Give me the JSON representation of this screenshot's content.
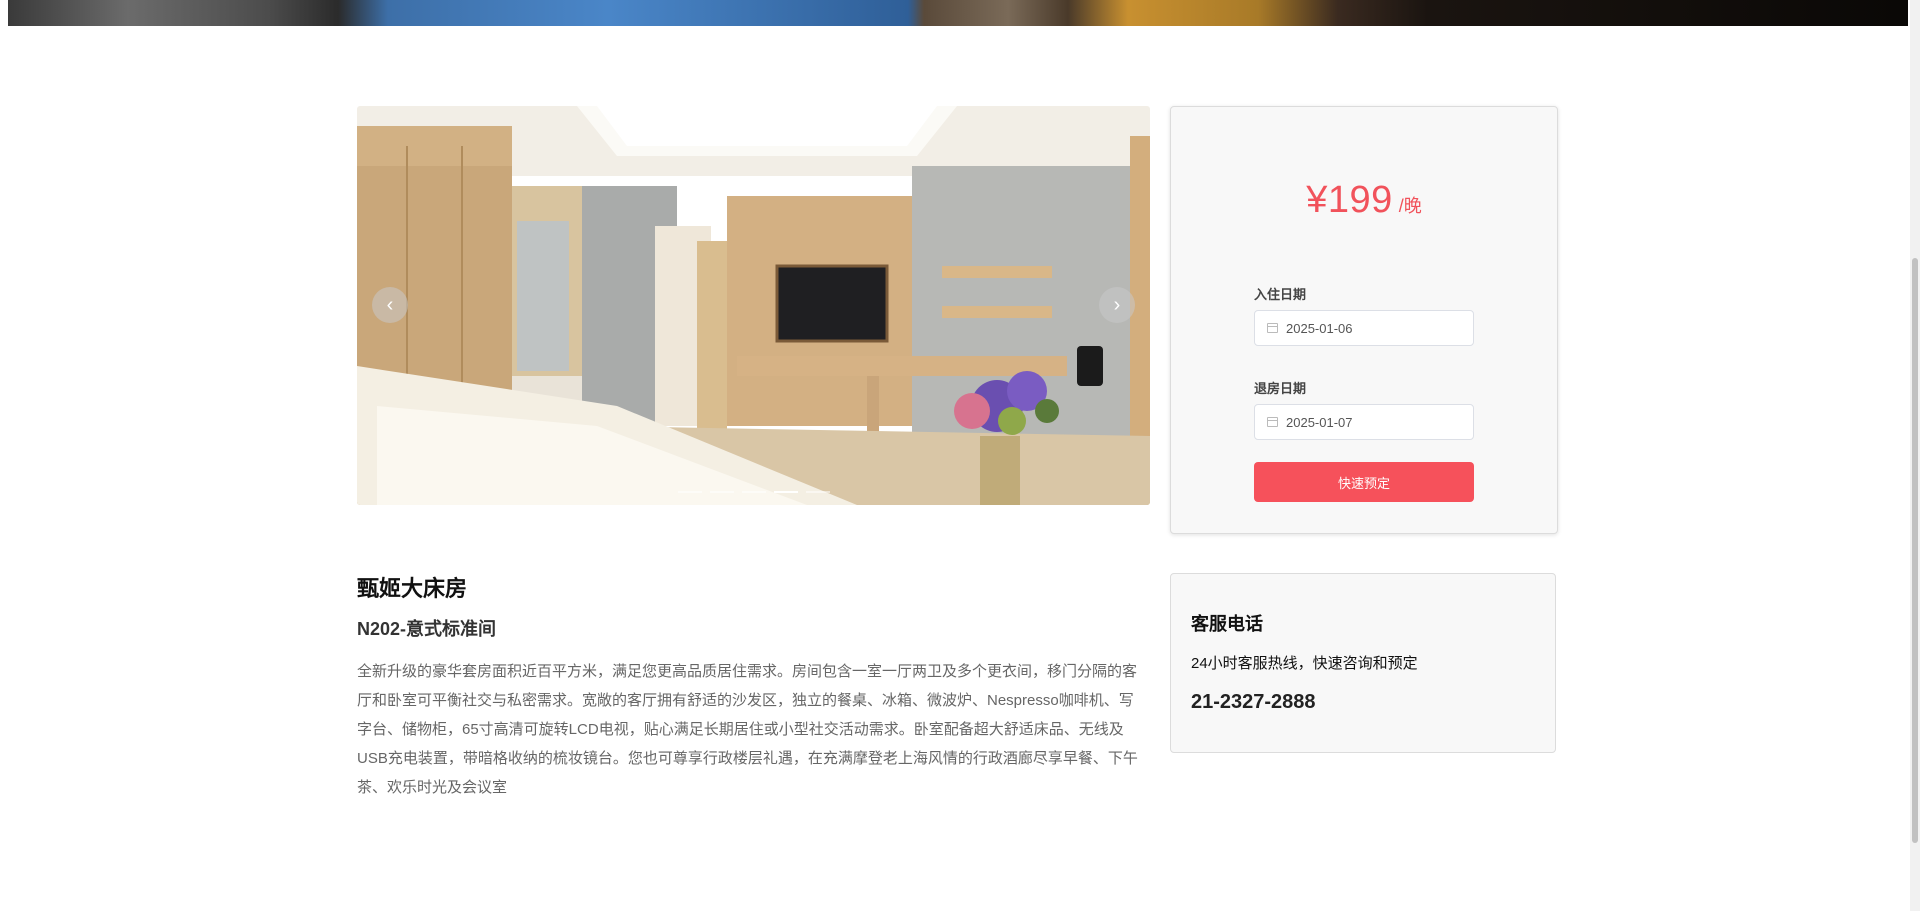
{
  "carousel": {
    "prev_glyph": "‹",
    "next_glyph": "›",
    "slide_count": 5,
    "active_slide": 3
  },
  "booking": {
    "price": "¥199",
    "unit": "/晚",
    "checkin_label": "入住日期",
    "checkin_value": "2025-01-06",
    "checkout_label": "退房日期",
    "checkout_value": "2025-01-07",
    "book_button": "快速预定"
  },
  "room": {
    "name": "甄姬大床房",
    "code": "N202-意式标准间",
    "description": "全新升级的豪华套房面积近百平方米，满足您更高品质居住需求。房间包含一室一厅两卫及多个更衣间，移门分隔的客厅和卧室可平衡社交与私密需求。宽敞的客厅拥有舒适的沙发区，独立的餐桌、冰箱、微波炉、Nespresso咖啡机、写字台、储物柜，65寸高清可旋转LCD电视，贴心满足长期居住或小型社交活动需求。卧室配备超大舒适床品、无线及USB充电装置，带暗格收纳的梳妆镜台。您也可尊享行政楼层礼遇，在充满摩登老上海风情的行政酒廊尽享早餐、下午茶、欢乐时光及会议室"
  },
  "service": {
    "title": "客服电话",
    "subtitle": "24小时客服热线，快速咨询和预定",
    "phone": "21-2327-2888"
  },
  "colors": {
    "accent": "#f6515b",
    "price": "#f1525b"
  },
  "icons": {
    "date": "calendar-icon",
    "prev": "chevron-left-icon",
    "next": "chevron-right-icon"
  }
}
